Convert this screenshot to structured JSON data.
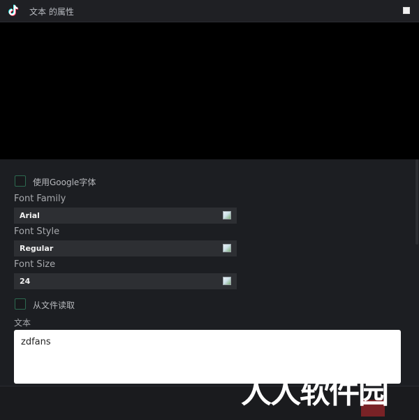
{
  "window": {
    "title": "文本 的属性",
    "icon": "tiktok-logo-icon",
    "maximize_icon": "maximize-icon"
  },
  "options": {
    "google_fonts": {
      "label": "使用Google字体",
      "checked": false
    },
    "read_from_file": {
      "label": "从文件读取",
      "checked": false
    }
  },
  "fields": {
    "font_family": {
      "label": "Font Family",
      "value": "Arial"
    },
    "font_style": {
      "label": "Font Style",
      "value": "Regular"
    },
    "font_size": {
      "label": "Font Size",
      "value": "24"
    }
  },
  "text": {
    "label": "文本",
    "value": "zdfans"
  },
  "watermark": {
    "text": "人人软件园"
  },
  "colors": {
    "background": "#1c1e22",
    "preview": "#000000",
    "field_bg": "#2d2f33",
    "checkbox_border": "#2d6a50"
  }
}
